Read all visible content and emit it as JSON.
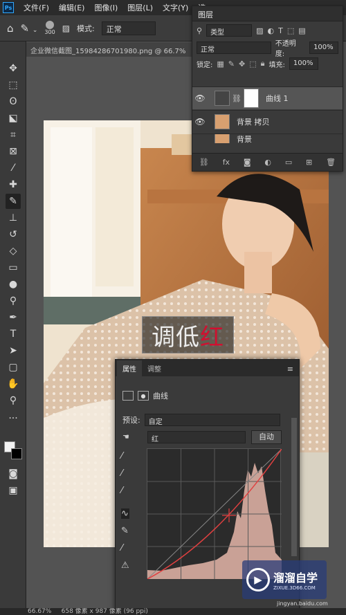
{
  "menu": {
    "items": [
      "文件(F)",
      "编辑(E)",
      "图像(I)",
      "图层(L)",
      "文字(Y)",
      "选"
    ]
  },
  "options": {
    "brush_size": "300",
    "mode_label": "模式:",
    "mode_value": "正常"
  },
  "document": {
    "tab_title": "企业微信截图_15984286701980.png @ 66.7%"
  },
  "canvas": {
    "text_plain": "调低",
    "text_red": "红"
  },
  "layers": {
    "title": "图层",
    "filter_kind": "类型",
    "blend_mode": "正常",
    "opacity_label": "不透明度:",
    "opacity_value": "100%",
    "lock_label": "锁定:",
    "fill_label": "填充:",
    "fill_value": "100%",
    "items": [
      {
        "name": "曲线 1"
      },
      {
        "name": "背景 拷贝"
      },
      {
        "name": "背景"
      }
    ]
  },
  "properties": {
    "tab_properties": "属性",
    "tab_adjust": "调整",
    "header": "曲线",
    "preset_label": "预设:",
    "preset_value": "自定",
    "channel_value": "红",
    "auto_button": "自动"
  },
  "status": {
    "zoom": "66.67%",
    "dims": "658 像素 x 987 像素 (96 ppi)"
  },
  "watermark": {
    "brand": "溜溜自学",
    "url": "ZIXUE.3D66.COM",
    "site": "jingyan.baidu.com"
  },
  "colors": {
    "curve_red": "#e04040",
    "accent": "#31a8ff",
    "panel_bg": "#3a3a3a"
  }
}
